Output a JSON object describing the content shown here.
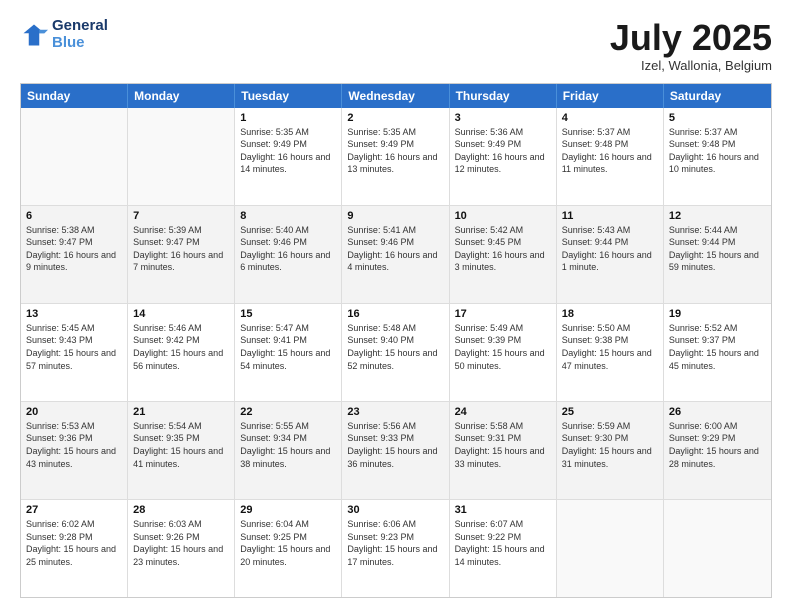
{
  "header": {
    "logo_line1": "General",
    "logo_line2": "Blue",
    "month": "July 2025",
    "location": "Izel, Wallonia, Belgium"
  },
  "weekdays": [
    "Sunday",
    "Monday",
    "Tuesday",
    "Wednesday",
    "Thursday",
    "Friday",
    "Saturday"
  ],
  "rows": [
    [
      {
        "day": "",
        "text": ""
      },
      {
        "day": "",
        "text": ""
      },
      {
        "day": "1",
        "text": "Sunrise: 5:35 AM\nSunset: 9:49 PM\nDaylight: 16 hours and 14 minutes."
      },
      {
        "day": "2",
        "text": "Sunrise: 5:35 AM\nSunset: 9:49 PM\nDaylight: 16 hours and 13 minutes."
      },
      {
        "day": "3",
        "text": "Sunrise: 5:36 AM\nSunset: 9:49 PM\nDaylight: 16 hours and 12 minutes."
      },
      {
        "day": "4",
        "text": "Sunrise: 5:37 AM\nSunset: 9:48 PM\nDaylight: 16 hours and 11 minutes."
      },
      {
        "day": "5",
        "text": "Sunrise: 5:37 AM\nSunset: 9:48 PM\nDaylight: 16 hours and 10 minutes."
      }
    ],
    [
      {
        "day": "6",
        "text": "Sunrise: 5:38 AM\nSunset: 9:47 PM\nDaylight: 16 hours and 9 minutes."
      },
      {
        "day": "7",
        "text": "Sunrise: 5:39 AM\nSunset: 9:47 PM\nDaylight: 16 hours and 7 minutes."
      },
      {
        "day": "8",
        "text": "Sunrise: 5:40 AM\nSunset: 9:46 PM\nDaylight: 16 hours and 6 minutes."
      },
      {
        "day": "9",
        "text": "Sunrise: 5:41 AM\nSunset: 9:46 PM\nDaylight: 16 hours and 4 minutes."
      },
      {
        "day": "10",
        "text": "Sunrise: 5:42 AM\nSunset: 9:45 PM\nDaylight: 16 hours and 3 minutes."
      },
      {
        "day": "11",
        "text": "Sunrise: 5:43 AM\nSunset: 9:44 PM\nDaylight: 16 hours and 1 minute."
      },
      {
        "day": "12",
        "text": "Sunrise: 5:44 AM\nSunset: 9:44 PM\nDaylight: 15 hours and 59 minutes."
      }
    ],
    [
      {
        "day": "13",
        "text": "Sunrise: 5:45 AM\nSunset: 9:43 PM\nDaylight: 15 hours and 57 minutes."
      },
      {
        "day": "14",
        "text": "Sunrise: 5:46 AM\nSunset: 9:42 PM\nDaylight: 15 hours and 56 minutes."
      },
      {
        "day": "15",
        "text": "Sunrise: 5:47 AM\nSunset: 9:41 PM\nDaylight: 15 hours and 54 minutes."
      },
      {
        "day": "16",
        "text": "Sunrise: 5:48 AM\nSunset: 9:40 PM\nDaylight: 15 hours and 52 minutes."
      },
      {
        "day": "17",
        "text": "Sunrise: 5:49 AM\nSunset: 9:39 PM\nDaylight: 15 hours and 50 minutes."
      },
      {
        "day": "18",
        "text": "Sunrise: 5:50 AM\nSunset: 9:38 PM\nDaylight: 15 hours and 47 minutes."
      },
      {
        "day": "19",
        "text": "Sunrise: 5:52 AM\nSunset: 9:37 PM\nDaylight: 15 hours and 45 minutes."
      }
    ],
    [
      {
        "day": "20",
        "text": "Sunrise: 5:53 AM\nSunset: 9:36 PM\nDaylight: 15 hours and 43 minutes."
      },
      {
        "day": "21",
        "text": "Sunrise: 5:54 AM\nSunset: 9:35 PM\nDaylight: 15 hours and 41 minutes."
      },
      {
        "day": "22",
        "text": "Sunrise: 5:55 AM\nSunset: 9:34 PM\nDaylight: 15 hours and 38 minutes."
      },
      {
        "day": "23",
        "text": "Sunrise: 5:56 AM\nSunset: 9:33 PM\nDaylight: 15 hours and 36 minutes."
      },
      {
        "day": "24",
        "text": "Sunrise: 5:58 AM\nSunset: 9:31 PM\nDaylight: 15 hours and 33 minutes."
      },
      {
        "day": "25",
        "text": "Sunrise: 5:59 AM\nSunset: 9:30 PM\nDaylight: 15 hours and 31 minutes."
      },
      {
        "day": "26",
        "text": "Sunrise: 6:00 AM\nSunset: 9:29 PM\nDaylight: 15 hours and 28 minutes."
      }
    ],
    [
      {
        "day": "27",
        "text": "Sunrise: 6:02 AM\nSunset: 9:28 PM\nDaylight: 15 hours and 25 minutes."
      },
      {
        "day": "28",
        "text": "Sunrise: 6:03 AM\nSunset: 9:26 PM\nDaylight: 15 hours and 23 minutes."
      },
      {
        "day": "29",
        "text": "Sunrise: 6:04 AM\nSunset: 9:25 PM\nDaylight: 15 hours and 20 minutes."
      },
      {
        "day": "30",
        "text": "Sunrise: 6:06 AM\nSunset: 9:23 PM\nDaylight: 15 hours and 17 minutes."
      },
      {
        "day": "31",
        "text": "Sunrise: 6:07 AM\nSunset: 9:22 PM\nDaylight: 15 hours and 14 minutes."
      },
      {
        "day": "",
        "text": ""
      },
      {
        "day": "",
        "text": ""
      }
    ]
  ]
}
